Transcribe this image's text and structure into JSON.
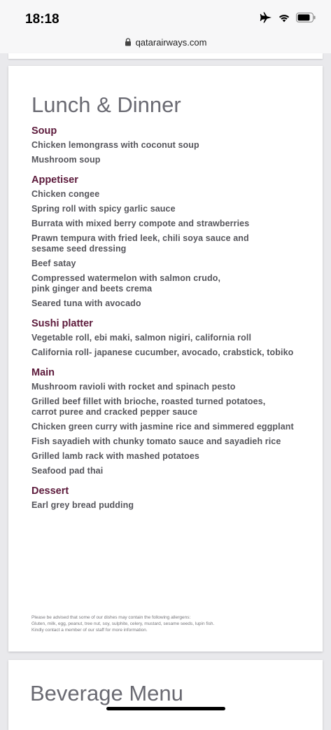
{
  "status": {
    "time": "18:18"
  },
  "browser": {
    "url": "qatarairways.com"
  },
  "menu_card": {
    "title": "Lunch & Dinner",
    "sections": [
      {
        "title": "Soup",
        "items": [
          "Chicken lemongrass with coconut soup",
          "Mushroom soup"
        ]
      },
      {
        "title": "Appetiser",
        "items": [
          "Chicken congee",
          "Spring roll with spicy garlic sauce",
          "Burrata with mixed berry compote and strawberries",
          "Prawn tempura with fried leek, chili soya sauce and sesame seed dressing",
          "Beef satay",
          "Compressed watermelon with salmon crudo, pink ginger and beets crema",
          "Seared tuna with avocado"
        ]
      },
      {
        "title": "Sushi platter",
        "items": [
          "Vegetable roll, ebi maki, salmon nigiri, california roll",
          "California roll- japanese cucumber, avocado, crabstick, tobiko"
        ]
      },
      {
        "title": "Main",
        "items": [
          "Mushroom ravioli with rocket and spinach pesto",
          "Grilled beef fillet with brioche, roasted turned potatoes, carrot puree and cracked pepper sauce",
          "Chicken green curry with jasmine rice and simmered eggplant",
          "Fish sayadieh with chunky tomato sauce and sayadieh rice",
          "Grilled lamb rack with mashed potatoes",
          "Seafood pad thai"
        ]
      },
      {
        "title": "Dessert",
        "items": [
          "Earl grey bread pudding"
        ]
      }
    ],
    "disclaimer": [
      "Please be advised that some of our dishes may contain the following allergens:",
      "Gluten, milk, egg, peanut, tree nut, soy, sulphite, celery, mustard, sesame seeds, lupin fish.",
      "Kindly contact a member of our staff for more information."
    ]
  },
  "next_card": {
    "title": "Beverage Menu"
  },
  "colors": {
    "section_title": "#5c1a3b",
    "item_text": "#56565c",
    "card_title": "#6a6a72"
  }
}
